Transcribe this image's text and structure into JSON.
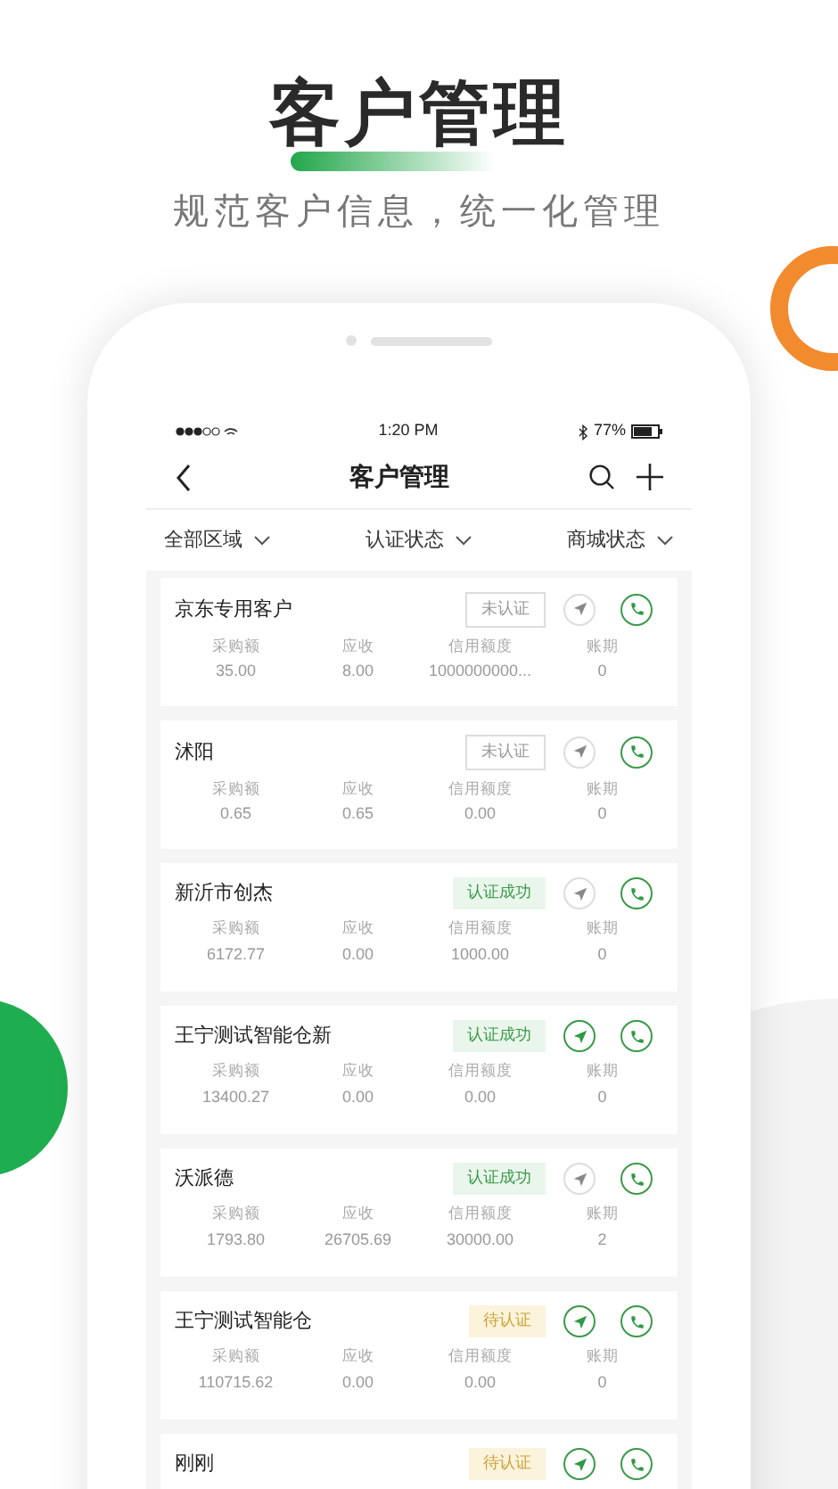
{
  "heading": {
    "title": "客户管理",
    "subtitle": "规范客户信息，统一化管理"
  },
  "status_bar": {
    "time": "1:20 PM",
    "battery": "77%"
  },
  "nav": {
    "title": "客户管理"
  },
  "filters": [
    "全部区域",
    "认证状态",
    "商城状态"
  ],
  "customers": [
    {
      "name": "京东专用客户",
      "status": "未认证",
      "kind": "unverified",
      "navigation_enabled": false,
      "stats": [
        {
          "label": "采购额",
          "value": "35.00"
        },
        {
          "label": "应收",
          "value": "8.00"
        },
        {
          "label": "信用额度",
          "value": "1000000000..."
        },
        {
          "label": "账期",
          "value": "0"
        }
      ]
    },
    {
      "name": "沭阳",
      "status": "未认证",
      "kind": "unverified",
      "navigation_enabled": false,
      "stats": [
        {
          "label": "采购额",
          "value": "0.65"
        },
        {
          "label": "应收",
          "value": "0.65"
        },
        {
          "label": "信用额度",
          "value": "0.00"
        },
        {
          "label": "账期",
          "value": "0"
        }
      ]
    },
    {
      "name": "新沂市创杰",
      "status": "认证成功",
      "kind": "verified",
      "navigation_enabled": false,
      "stats": [
        {
          "label": "采购额",
          "value": "6172.77"
        },
        {
          "label": "应收",
          "value": "0.00"
        },
        {
          "label": "信用额度",
          "value": "1000.00"
        },
        {
          "label": "账期",
          "value": "0"
        }
      ]
    },
    {
      "name": "王宁测试智能仓新",
      "status": "认证成功",
      "kind": "verified",
      "navigation_enabled": true,
      "stats": [
        {
          "label": "采购额",
          "value": "13400.27"
        },
        {
          "label": "应收",
          "value": "0.00"
        },
        {
          "label": "信用额度",
          "value": "0.00"
        },
        {
          "label": "账期",
          "value": "0"
        }
      ]
    },
    {
      "name": "沃派德",
      "status": "认证成功",
      "kind": "verified",
      "navigation_enabled": false,
      "stats": [
        {
          "label": "采购额",
          "value": "1793.80"
        },
        {
          "label": "应收",
          "value": "26705.69"
        },
        {
          "label": "信用额度",
          "value": "30000.00"
        },
        {
          "label": "账期",
          "value": "2"
        }
      ]
    },
    {
      "name": "王宁测试智能仓",
      "status": "待认证",
      "kind": "pending",
      "navigation_enabled": true,
      "stats": [
        {
          "label": "采购额",
          "value": "110715.62"
        },
        {
          "label": "应收",
          "value": "0.00"
        },
        {
          "label": "信用额度",
          "value": "0.00"
        },
        {
          "label": "账期",
          "value": "0"
        }
      ]
    },
    {
      "name": "刚刚",
      "status": "待认证",
      "kind": "pending",
      "navigation_enabled": true
    }
  ]
}
